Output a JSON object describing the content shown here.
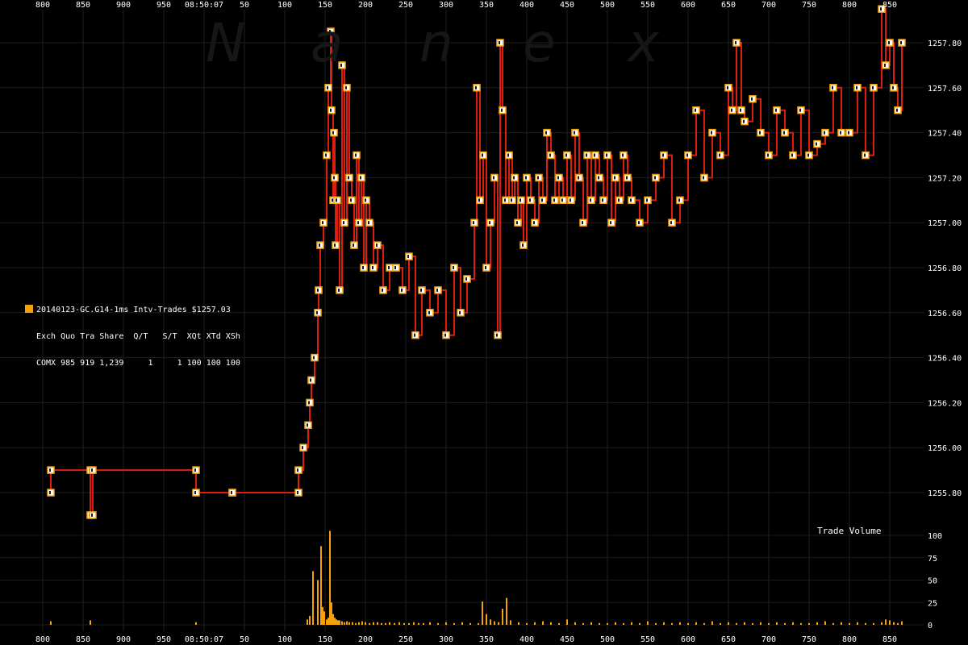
{
  "chart_data": {
    "type": "line",
    "title": "20140123-GC.G14-1ms Intv-Trades $1257.03",
    "time_axis": {
      "ticks": [
        "800",
        "850",
        "900",
        "950",
        "08:50:07",
        "50",
        "100",
        "150",
        "200",
        "250",
        "300",
        "350",
        "400",
        "450",
        "500",
        "550",
        "600",
        "650",
        "700",
        "750",
        "800",
        "850"
      ],
      "units": "ms"
    },
    "price_axis": {
      "ticks": [
        "1257.80",
        "1257.60",
        "1257.40",
        "1257.20",
        "1257.00",
        "1256.80",
        "1256.60",
        "1256.40",
        "1256.20",
        "1256.00",
        "1255.80"
      ],
      "ylim": [
        1255.72,
        1257.97
      ]
    },
    "volume_axis": {
      "label": "Trade Volume",
      "ticks": [
        "100",
        "75",
        "50",
        "25",
        "0"
      ],
      "ylim": [
        0,
        100
      ]
    },
    "series": [
      {
        "name": "COMX",
        "color": "#f5a20a",
        "line_color": "#dd1e0e",
        "x": [
          -190,
          -190,
          -141,
          -141,
          -138,
          -138,
          -10,
          -10,
          35,
          35,
          117,
          117,
          123,
          129,
          131,
          133,
          137,
          141,
          142,
          144,
          148,
          152,
          154,
          157,
          158,
          160,
          161,
          162,
          163,
          165,
          168,
          171,
          174,
          177,
          180,
          183,
          186,
          189,
          192,
          195,
          198,
          201,
          205,
          210,
          215,
          222,
          230,
          238,
          246,
          254,
          262,
          270,
          280,
          290,
          300,
          310,
          318,
          326,
          335,
          338,
          342,
          346,
          350,
          355,
          360,
          364,
          367,
          370,
          374,
          378,
          382,
          385,
          389,
          393,
          396,
          400,
          405,
          410,
          415,
          420,
          425,
          430,
          435,
          440,
          445,
          450,
          455,
          460,
          465,
          470,
          475,
          480,
          485,
          490,
          495,
          500,
          505,
          510,
          515,
          520,
          525,
          530,
          540,
          550,
          560,
          570,
          580,
          590,
          600,
          610,
          620,
          630,
          640,
          650,
          655,
          660,
          666,
          670,
          680,
          690,
          700,
          710,
          720,
          730,
          740,
          750,
          760,
          770,
          780,
          790,
          800,
          810,
          820,
          830,
          840,
          845,
          850,
          855,
          860,
          865
        ],
        "y": [
          1255.8,
          1255.9,
          1255.9,
          1255.7,
          1255.7,
          1255.9,
          1255.9,
          1255.8,
          1255.8,
          1255.8,
          1255.8,
          1255.9,
          1256.0,
          1256.1,
          1256.2,
          1256.3,
          1256.4,
          1256.6,
          1256.7,
          1256.9,
          1257.0,
          1257.3,
          1257.6,
          1257.85,
          1257.5,
          1257.1,
          1257.4,
          1257.2,
          1256.9,
          1257.1,
          1256.7,
          1257.7,
          1257.0,
          1257.6,
          1257.2,
          1257.1,
          1256.9,
          1257.3,
          1257.0,
          1257.2,
          1256.8,
          1257.1,
          1257.0,
          1256.8,
          1256.9,
          1256.7,
          1256.8,
          1256.8,
          1256.7,
          1256.85,
          1256.5,
          1256.7,
          1256.6,
          1256.7,
          1256.5,
          1256.8,
          1256.6,
          1256.75,
          1257.0,
          1257.6,
          1257.1,
          1257.3,
          1256.8,
          1257.0,
          1257.2,
          1256.5,
          1257.8,
          1257.5,
          1257.1,
          1257.3,
          1257.1,
          1257.2,
          1257.0,
          1257.1,
          1256.9,
          1257.2,
          1257.1,
          1257.0,
          1257.2,
          1257.1,
          1257.4,
          1257.3,
          1257.1,
          1257.2,
          1257.1,
          1257.3,
          1257.1,
          1257.4,
          1257.2,
          1257.0,
          1257.3,
          1257.1,
          1257.3,
          1257.2,
          1257.1,
          1257.3,
          1257.0,
          1257.2,
          1257.1,
          1257.3,
          1257.2,
          1257.1,
          1257.0,
          1257.1,
          1257.2,
          1257.3,
          1257.0,
          1257.1,
          1257.3,
          1257.5,
          1257.2,
          1257.4,
          1257.3,
          1257.6,
          1257.5,
          1257.8,
          1257.5,
          1257.45,
          1257.55,
          1257.4,
          1257.3,
          1257.5,
          1257.4,
          1257.3,
          1257.5,
          1257.3,
          1257.35,
          1257.4,
          1257.6,
          1257.4,
          1257.4,
          1257.6,
          1257.3,
          1257.6,
          1257.95,
          1257.7,
          1257.8,
          1257.6,
          1257.5,
          1257.8
        ]
      }
    ],
    "volume_series": {
      "name": "COMX",
      "color": "#f5a20a",
      "x": [
        -190,
        -141,
        -10,
        128,
        131,
        135,
        141,
        145,
        147,
        149,
        152,
        154,
        156,
        158,
        160,
        162,
        164,
        166,
        168,
        171,
        174,
        177,
        180,
        184,
        188,
        192,
        196,
        200,
        205,
        210,
        215,
        220,
        225,
        230,
        236,
        242,
        248,
        254,
        260,
        266,
        272,
        280,
        290,
        300,
        310,
        320,
        330,
        340,
        345,
        350,
        355,
        360,
        365,
        370,
        375,
        380,
        390,
        400,
        410,
        420,
        430,
        440,
        450,
        460,
        470,
        480,
        490,
        500,
        510,
        520,
        530,
        540,
        550,
        560,
        570,
        580,
        590,
        600,
        610,
        620,
        630,
        640,
        650,
        660,
        670,
        680,
        690,
        700,
        710,
        720,
        730,
        740,
        750,
        760,
        770,
        780,
        790,
        800,
        810,
        820,
        830,
        840,
        845,
        850,
        855,
        860,
        865
      ],
      "values": [
        4,
        5,
        3,
        6,
        10,
        60,
        50,
        88,
        20,
        15,
        6,
        8,
        105,
        25,
        12,
        8,
        6,
        5,
        5,
        4,
        3,
        4,
        3,
        3,
        2,
        3,
        4,
        3,
        2,
        3,
        3,
        2,
        2,
        3,
        2,
        3,
        2,
        2,
        3,
        2,
        2,
        3,
        2,
        3,
        2,
        3,
        2,
        2,
        26,
        12,
        6,
        4,
        3,
        18,
        30,
        5,
        3,
        2,
        3,
        4,
        3,
        2,
        6,
        3,
        2,
        3,
        2,
        2,
        3,
        2,
        3,
        2,
        4,
        2,
        3,
        2,
        3,
        2,
        3,
        2,
        4,
        2,
        3,
        2,
        3,
        2,
        3,
        2,
        3,
        2,
        3,
        2,
        2,
        3,
        4,
        2,
        3,
        2,
        3,
        2,
        2,
        3,
        6,
        5,
        3,
        2,
        4
      ]
    }
  },
  "info_panel": {
    "line1": "20140123-GC.G14-1ms Intv-Trades $1257.03",
    "line2": "Exch Quo Tra Share  Q/T   S/T  XQt XTd XSh",
    "line3": "COMX 985 919 1,239     1     1 100 100 100"
  },
  "volume_label": "Trade Volume",
  "watermark": [
    "N",
    "a",
    "n",
    "e",
    "x"
  ]
}
